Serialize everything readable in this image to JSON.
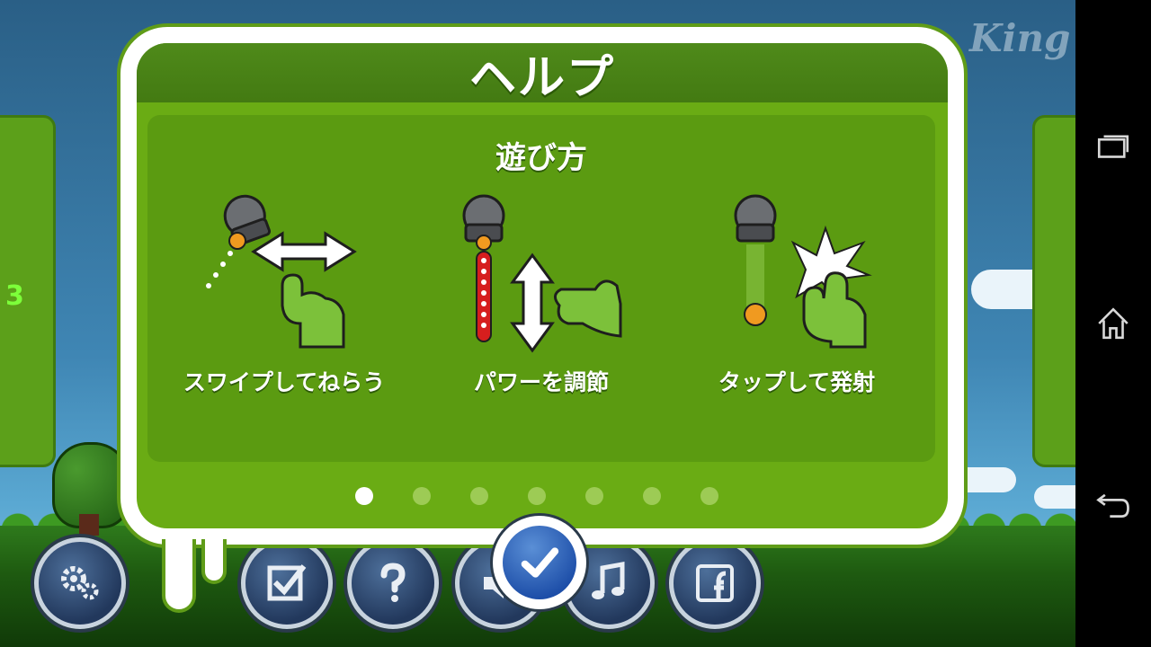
{
  "dialog": {
    "title": "ヘルプ",
    "subtitle": "遊び方",
    "steps": [
      {
        "label": "スワイプしてねらう",
        "icon": "swipe-aim-icon"
      },
      {
        "label": "パワーを調節",
        "icon": "adjust-power-icon"
      },
      {
        "label": "タップして発射",
        "icon": "tap-fire-icon"
      }
    ],
    "pages": {
      "total": 7,
      "current": 1
    },
    "confirm_icon": "checkmark-icon"
  },
  "background": {
    "brand_logo": "King",
    "left_panel_number": "3"
  },
  "toolbar": {
    "buttons": [
      {
        "icon": "settings-gears-icon"
      },
      {
        "icon": "checklist-icon"
      },
      {
        "icon": "help-question-icon"
      },
      {
        "icon": "sound-speaker-icon"
      },
      {
        "icon": "music-note-icon"
      },
      {
        "icon": "facebook-icon"
      }
    ]
  },
  "navbar": {
    "buttons": [
      {
        "icon": "recent-apps-icon"
      },
      {
        "icon": "home-icon"
      },
      {
        "icon": "back-icon"
      }
    ]
  },
  "colors": {
    "dialog_green": "#6aac14",
    "title_bar_green": "#437a12",
    "panel_green": "#5b9b11",
    "active_dot": "#ffffff",
    "inactive_dot": "#9dcb55",
    "button_blue": "#1d4ea8"
  }
}
